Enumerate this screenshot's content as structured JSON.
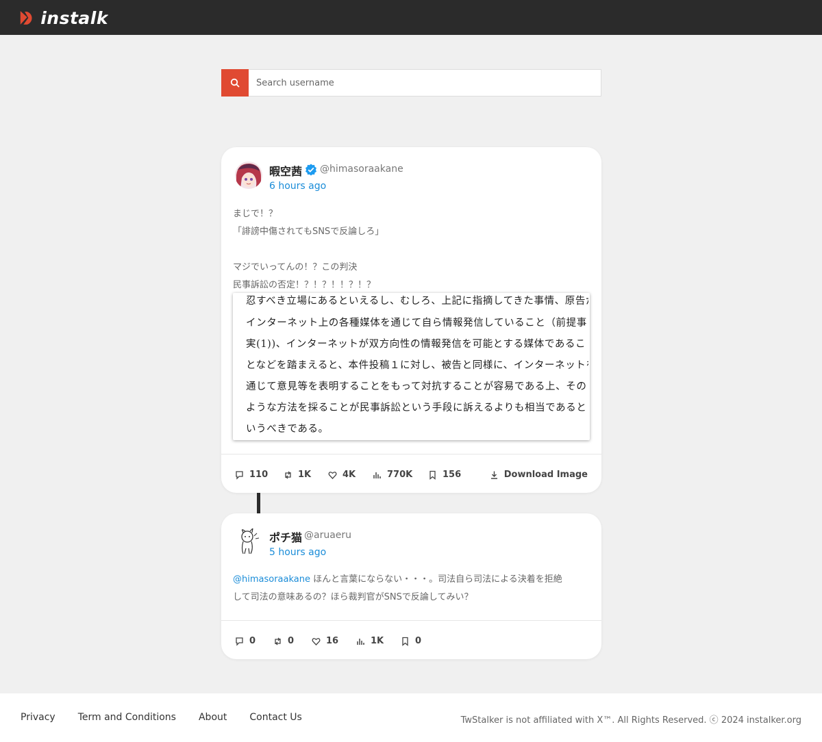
{
  "header": {
    "logo_text": "instalk",
    "brand_color": "#e04a32"
  },
  "search": {
    "placeholder": "Search username",
    "button_icon": "search-icon"
  },
  "posts": [
    {
      "display_name": "暇空茜",
      "verified": true,
      "handle": "@himasoraakane",
      "time": "6 hours ago",
      "text_lines": [
        "まじで！？",
        "「誹謗中傷されてもSNSで反論しろ」",
        "",
        "マジでいってんの！？この判決",
        "民事訴訟の否定！？！？！！？！？"
      ],
      "image_text_lines": [
        "忍すべき立場にあるといえるし、むしろ、上記に指摘してきた事情、原告が",
        "インターネット上の各種媒体を通じて自ら情報発信していること（前提事",
        "実(1))、インターネットが双方向性の情報発信を可能とする媒体であるこ",
        "となどを踏まえると、本件投稿１に対し、被告と同様に、インターネットを",
        "通じて意見等を表明することをもって対抗することが容易である上、その",
        "ような方法を採ることが民事訴訟という手段に訴えるよりも相当であると",
        "いうべきである。"
      ],
      "stats": [
        {
          "icon": "reply-icon",
          "value": "110"
        },
        {
          "icon": "retweet-icon",
          "value": "1K"
        },
        {
          "icon": "heart-icon",
          "value": "4K"
        },
        {
          "icon": "views-icon",
          "value": "770K"
        },
        {
          "icon": "bookmark-icon",
          "value": "156"
        }
      ],
      "download_label": "Download Image"
    },
    {
      "display_name": "ポチ猫",
      "verified": false,
      "handle": "@aruaeru",
      "time": "5 hours ago",
      "mention": "@himasoraakane",
      "text_line1": " ほんと言葉にならない・・・。司法自ら司法による決着を拒絶",
      "text_line2": "して司法の意味あるの？ほら裁判官がSNSで反論してみい？",
      "stats": [
        {
          "icon": "reply-icon",
          "value": "0"
        },
        {
          "icon": "retweet-icon",
          "value": "0"
        },
        {
          "icon": "heart-icon",
          "value": "16"
        },
        {
          "icon": "views-icon",
          "value": "1K"
        },
        {
          "icon": "bookmark-icon",
          "value": "0"
        }
      ]
    }
  ],
  "footer": {
    "links": [
      "Privacy",
      "Term and Conditions",
      "About",
      "Contact Us"
    ],
    "copyright": "TwStalker is not affiliated with X™. All Rights Reserved. ⓒ 2024 instalker.org"
  }
}
